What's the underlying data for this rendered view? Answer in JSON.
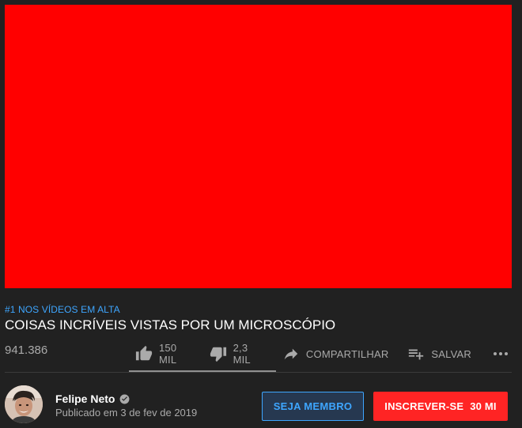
{
  "player": {
    "color": "#ff0000"
  },
  "video": {
    "trending_badge": "#1 NOS VÍDEOS EM ALTA",
    "title": "COISAS INCRÍVEIS VISTAS POR UM MICROSCÓPIO",
    "views": "941.386"
  },
  "actions": {
    "likes": "150 MIL",
    "dislikes": "2,3 MIL",
    "share": "COMPARTILHAR",
    "save": "SALVAR",
    "like_ratio": 0.98
  },
  "channel": {
    "name": "Felipe Neto",
    "published": "Publicado em 3 de fev de 2019",
    "verified_icon": "verified-check-icon"
  },
  "buttons": {
    "member": "SEJA MEMBRO",
    "subscribe": "INSCREVER-SE",
    "subscriber_count": "30 MI"
  },
  "colors": {
    "background": "#212121",
    "accent_blue": "#3ea6ff",
    "subscribe_red": "#ff2424"
  }
}
